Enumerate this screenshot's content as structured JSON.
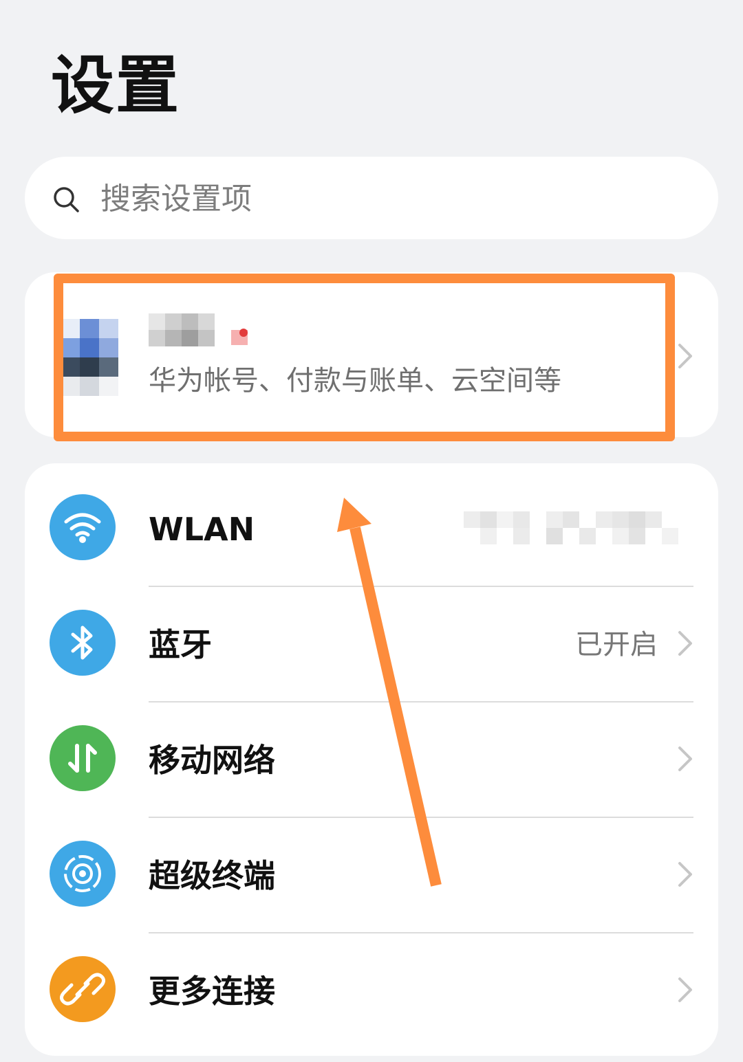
{
  "page": {
    "title": "设置"
  },
  "search": {
    "placeholder": "搜索设置项",
    "icon": "search-icon"
  },
  "account": {
    "subtitle": "华为帐号、付款与账单、云空间等",
    "avatar_icon": "avatar",
    "name_blurred": true
  },
  "settings": {
    "items": [
      {
        "label": "WLAN",
        "value": "",
        "icon": "wifi-icon",
        "color": "#3fa8e6"
      },
      {
        "label": "蓝牙",
        "value": "已开启",
        "icon": "bluetooth-icon",
        "color": "#3fa8e6"
      },
      {
        "label": "移动网络",
        "value": "",
        "icon": "mobile-data-icon",
        "color": "#4fb656"
      },
      {
        "label": "超级终端",
        "value": "",
        "icon": "super-device-icon",
        "color": "#3fa8e6"
      },
      {
        "label": "更多连接",
        "value": "",
        "icon": "link-icon",
        "color": "#f39a1f"
      }
    ]
  },
  "colors": {
    "background": "#f1f2f4",
    "card": "#ffffff",
    "annotation": "#fd8c3c"
  }
}
